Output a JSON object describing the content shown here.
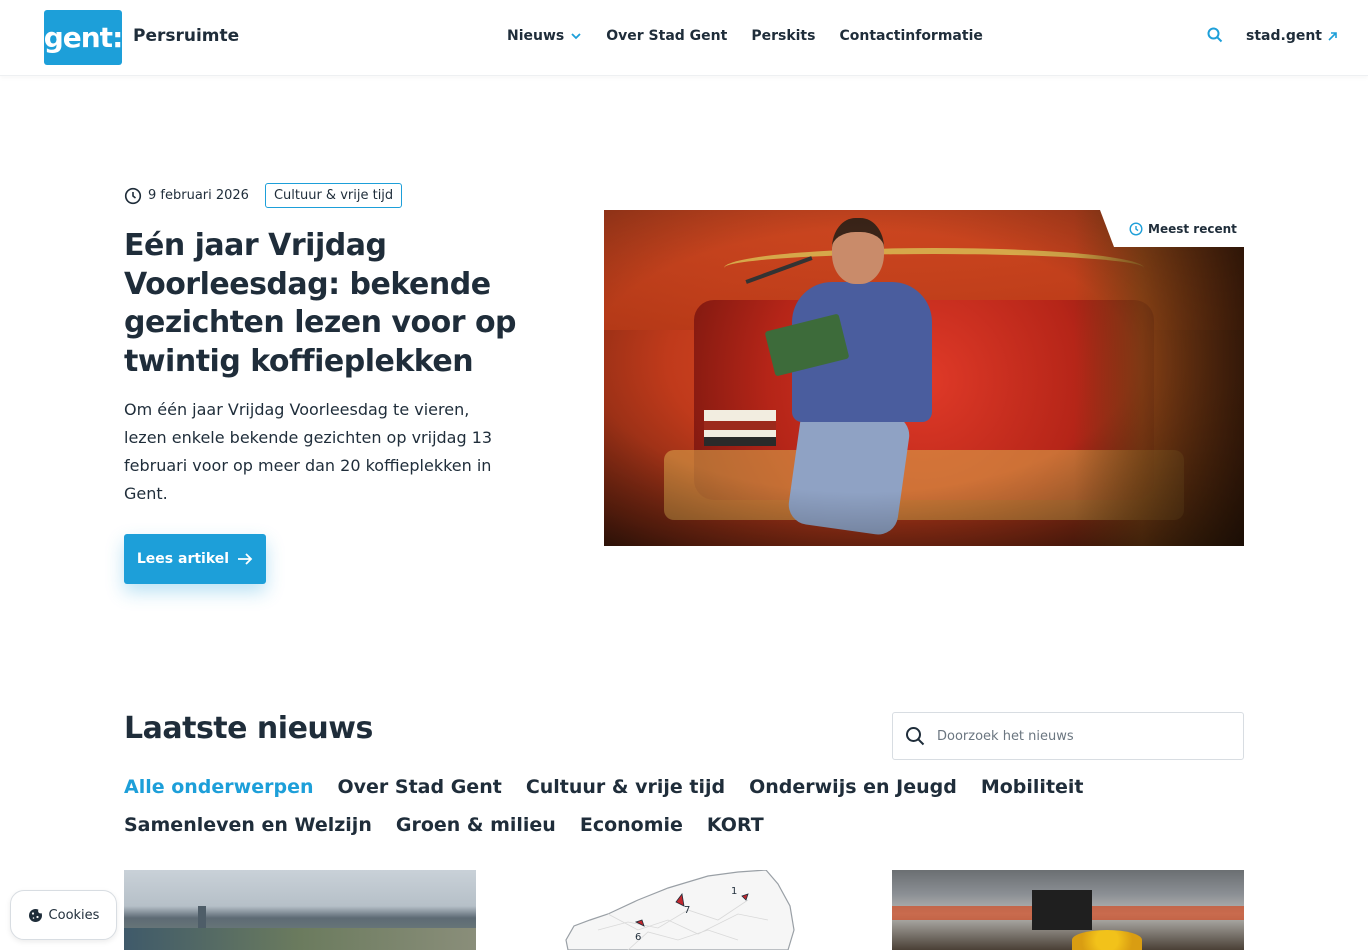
{
  "header": {
    "logo_text": "gent:",
    "site_name": "Persruimte",
    "nav": [
      {
        "label": "Nieuws"
      },
      {
        "label": "Over Stad Gent"
      },
      {
        "label": "Perskits"
      },
      {
        "label": "Contactinformatie"
      }
    ],
    "external_link": "stad.gent"
  },
  "hero": {
    "date": "9 februari 2026",
    "tag": "Cultuur & vrije tijd",
    "title": "Eén jaar Vrijdag Voorleesdag: bekende gezichten lezen voor op twintig koffieplekken",
    "text": "Om één jaar Vrijdag Voorleesdag te vieren, lezen enkele bekende gezichten op vrijdag 13 februari voor op meer dan 20 koffieplekken in Gent.",
    "cta": "Lees artikel",
    "badge": "Meest recent"
  },
  "latest": {
    "title": "Laatste nieuws",
    "search_placeholder": "Doorzoek het nieuws",
    "topics": [
      {
        "label": "Alle onderwerpen",
        "active": true
      },
      {
        "label": "Over Stad Gent"
      },
      {
        "label": "Cultuur & vrije tijd"
      },
      {
        "label": "Onderwijs en Jeugd"
      },
      {
        "label": "Mobiliteit"
      },
      {
        "label": "Samenleven en Welzijn"
      },
      {
        "label": "Groen & milieu"
      },
      {
        "label": "Economie"
      },
      {
        "label": "KORT"
      }
    ],
    "map_labels": [
      "1",
      "7",
      "6"
    ]
  },
  "cookies": {
    "label": "Cookies"
  },
  "colors": {
    "accent": "#1d9fd9",
    "text": "#1f2d3a"
  }
}
